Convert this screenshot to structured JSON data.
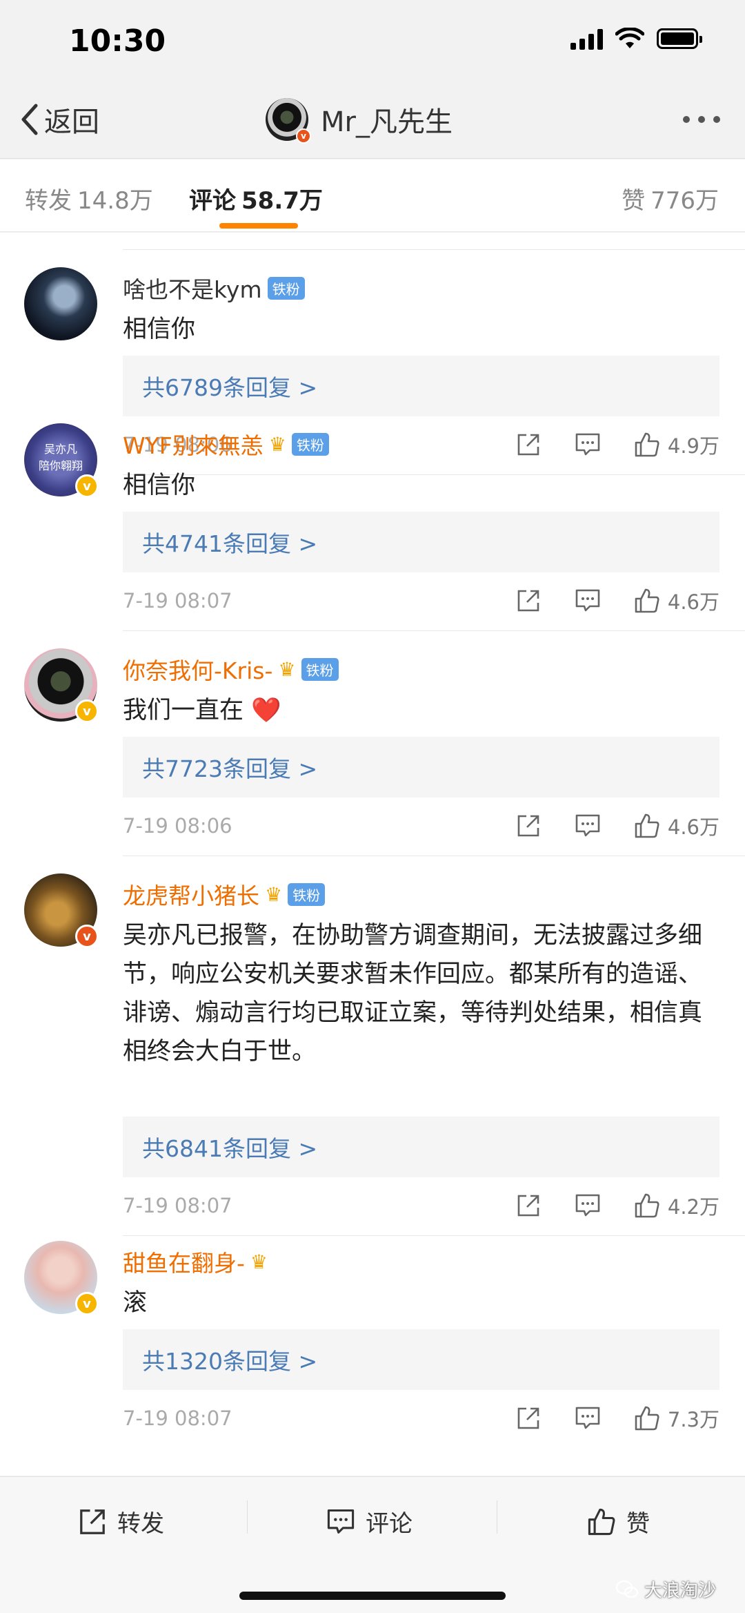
{
  "status_bar": {
    "time": "10:30"
  },
  "nav": {
    "back_label": "返回",
    "title": "Mr_凡先生"
  },
  "tabs": {
    "repost": {
      "label": "转发",
      "count": "14.8万"
    },
    "comments": {
      "label": "评论",
      "count": "58.7万"
    },
    "likes": {
      "label": "赞",
      "count": "776万"
    }
  },
  "comments": [
    {
      "name": "啥也不是kym",
      "badge": "铁粉",
      "text": "相信你",
      "replies": "共6789条回复 >",
      "time": "7-19 08:06",
      "likes": "4.9万"
    },
    {
      "name": "WYF别來無恙",
      "badge": "铁粉",
      "text": "相信你",
      "replies": "共4741条回复 >",
      "time": "7-19 08:07",
      "likes": "4.6万",
      "avatar_text_1": "吴亦凡",
      "avatar_text_2": "陪你翱翔"
    },
    {
      "name": "你奈我何-Kris-",
      "badge": "铁粉",
      "text": "我们一直在",
      "emoji": "❤️",
      "replies": "共7723条回复 >",
      "time": "7-19 08:06",
      "likes": "4.6万"
    },
    {
      "name": "龙虎帮小猪长",
      "badge": "铁粉",
      "text": "吴亦凡已报警，在协助警方调查期间，无法披露过多细节，响应公安机关要求暂未作回应。都某所有的造谣、诽谤、煽动言行均已取证立案，等待判处结果，相信真相终会大白于世。",
      "replies": "共6841条回复 >",
      "time": "7-19 08:07",
      "likes": "4.2万"
    },
    {
      "name": "甜鱼在翻身-",
      "text": "滚",
      "replies": "共1320条回复 >",
      "time": "7-19 08:07",
      "likes": "7.3万"
    }
  ],
  "bottom_bar": {
    "repost_label": "转发",
    "comment_label": "评论",
    "like_label": "赞"
  },
  "watermark": "大浪淘沙",
  "colors": {
    "accent": "#ff8200",
    "vip_name": "#f06d00",
    "link": "#4a7bb4",
    "verified": "#f7b500"
  }
}
